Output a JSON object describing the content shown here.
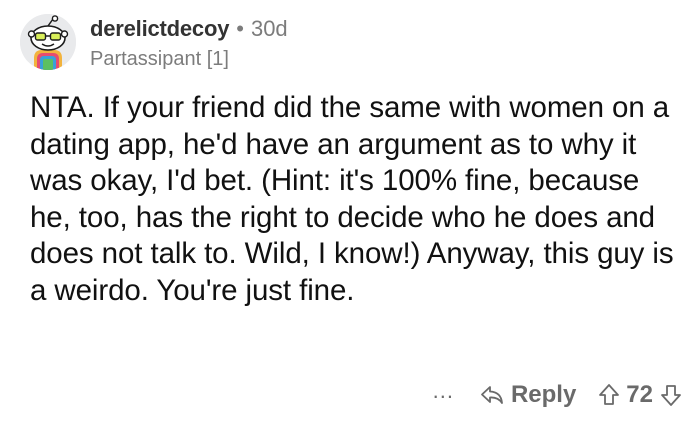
{
  "comment": {
    "username": "derelictdecoy",
    "separator": "•",
    "age": "30d",
    "flair": "Partassipant [1]",
    "body": "NTA. If your friend did the same with women on a dating app, he'd have an argument as to why it was okay, I'd bet. (Hint: it's 100% fine, because he, too, has the right to decide who he does and does not talk to. Wild, I know!) Anyway, this guy is a weirdo. You're just fine."
  },
  "actions": {
    "more_label": "...",
    "reply_label": "Reply",
    "score": "72"
  },
  "icons": {
    "avatar": "snoo-avatar",
    "reply": "reply-arrow-icon",
    "upvote": "upvote-arrow-icon",
    "downvote": "downvote-arrow-icon"
  },
  "colors": {
    "text": "#1c1c1c",
    "meta": "#7c7c7c",
    "action": "#6a6a6a",
    "avatar_bg": "#e9eaec"
  }
}
